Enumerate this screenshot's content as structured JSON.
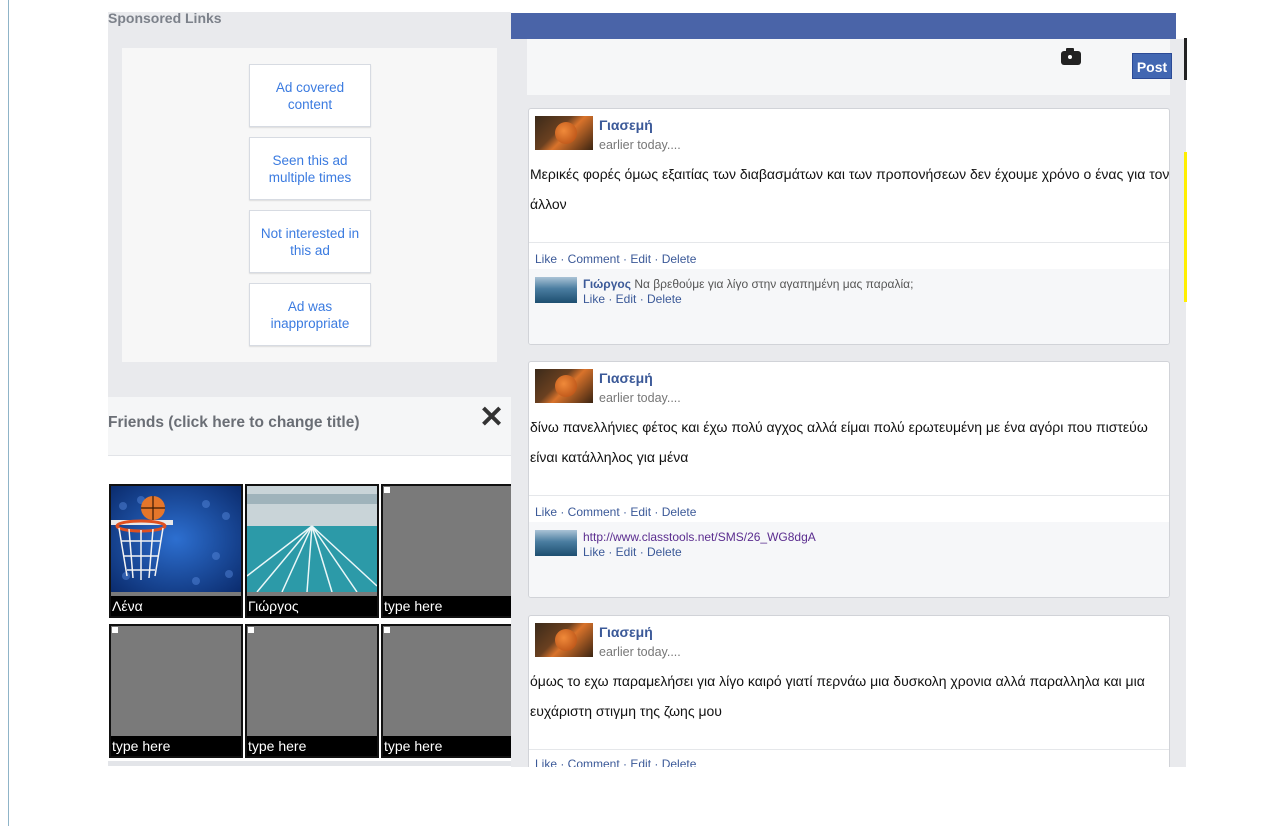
{
  "sponsored": {
    "title": "Sponsored Links",
    "ad_options": [
      "Ad covered content",
      "Seen this ad multiple times",
      "Not interested in this ad",
      "Ad was inappropriate"
    ]
  },
  "friends": {
    "title": "Friends (click here to change title)",
    "close_icon": "close-icon",
    "items": [
      {
        "label": "Λένα",
        "image": "basketball-hoop"
      },
      {
        "label": "Γιώργος",
        "image": "swimming-pool"
      },
      {
        "label": "type here",
        "image": ""
      },
      {
        "label": "type here",
        "image": ""
      },
      {
        "label": "type here",
        "image": ""
      },
      {
        "label": "type here",
        "image": ""
      }
    ]
  },
  "composer": {
    "camera_icon": "camera-icon",
    "post_label": "Post"
  },
  "posts": [
    {
      "author": "Γιασεμή",
      "time": "earlier today....",
      "text": "Μερικές φορές όμως εξαιτίας των διαβασμάτων και των προπονήσεων δεν έχουμε χρόνο ο ένας για τον άλλον",
      "actions": "Like · Comment · Edit · Delete",
      "comment": {
        "name": "Γιώργος",
        "text": "Να βρεθούμε για λίγο στην αγαπημένη μας παραλία;",
        "actions": "Like · Edit · Delete"
      }
    },
    {
      "author": "Γιασεμή",
      "time": "earlier today....",
      "text": "δίνω πανελλήνιες φέτος και έχω πολύ αγχος αλλά είμαι πολύ ερωτευμένη με ένα αγόρι που πιστεύω είναι κατάλληλος για μένα",
      "actions": "Like · Comment · Edit · Delete",
      "comment": {
        "name": "",
        "text": "http://www.classtools.net/SMS/26_WG8dgA",
        "actions": "Like · Edit · Delete"
      }
    },
    {
      "author": "Γιασεμή",
      "time": "earlier today....",
      "text": "όμως το εχω παραμελήσει για λίγο καιρό γιατί περνάω μια δυσκολη χρονια αλλά παραλληλα και μια ευχάριστη στιγμη της ζωης μου",
      "actions": "Like · Comment · Edit · Delete"
    }
  ],
  "colors": {
    "brand": "#4a64a8",
    "link": "#3b5998",
    "ad_text": "#3b7be0"
  }
}
